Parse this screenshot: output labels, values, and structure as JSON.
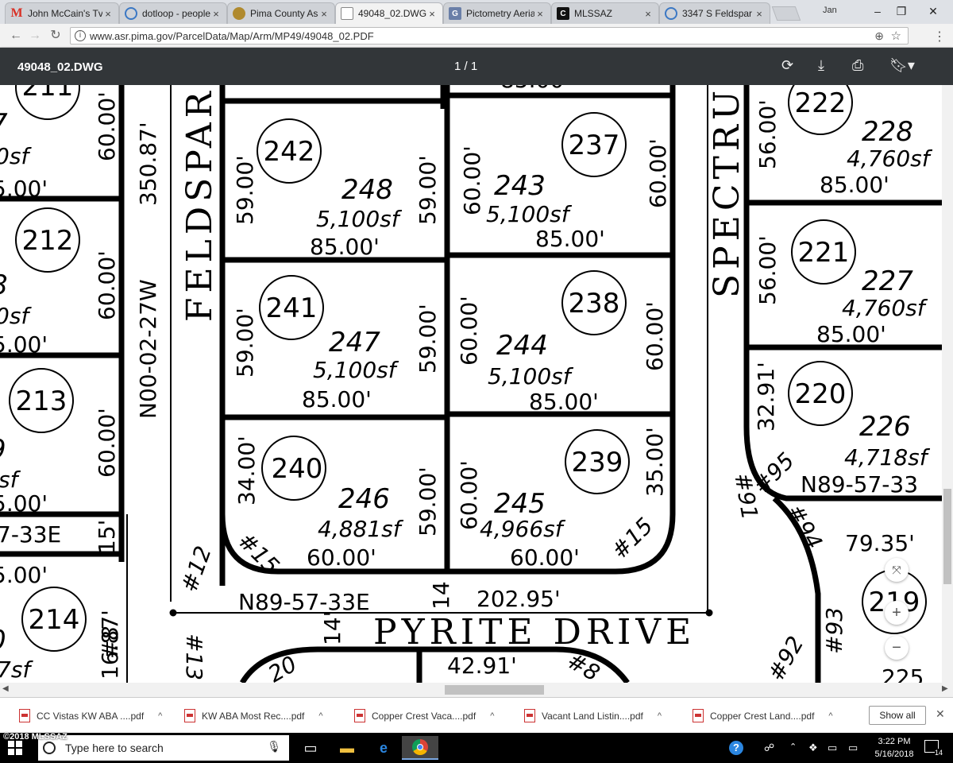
{
  "browser": {
    "tabs": [
      {
        "label": "John McCain's Tv",
        "icon": "gmail-icon",
        "active": false
      },
      {
        "label": "dotloop - people",
        "icon": "dotloop-icon",
        "active": false
      },
      {
        "label": "Pima County Ass",
        "icon": "pima-county-icon",
        "active": false
      },
      {
        "label": "49048_02.DWG",
        "icon": "document-icon",
        "active": true
      },
      {
        "label": "Pictometry Aeria",
        "icon": "pictometry-icon",
        "active": false
      },
      {
        "label": "MLSSAZ",
        "icon": "mlssaz-icon",
        "active": false
      },
      {
        "label": "3347 S Feldspar",
        "icon": "location-icon",
        "active": false
      }
    ],
    "user_label": "Jan",
    "url": "www.asr.pima.gov/ParcelData/Map/Arm/MP49/49048_02.PDF"
  },
  "pdf": {
    "filename": "49048_02.DWG",
    "page_indicator": "1  /  1"
  },
  "plat": {
    "street_labels": {
      "feldspar": "FELDSPAR",
      "spectrum": "SPECTRUM",
      "pyrite": "PYRITE  DRIVE"
    },
    "bearings": {
      "west_line": "N00-02-27W",
      "south_line": "N89-57-33E",
      "left_frag": "7-33E",
      "right_frag": "N89-57-33"
    },
    "distances": {
      "west_total": "350.87'",
      "south_total": "202.95'",
      "top_center": "85.00'",
      "lower_center": "42.91'",
      "right_79": "79.35'",
      "left_1687": "16.87'",
      "left_15": "15'",
      "row_14a": "14",
      "row_14b": "14'",
      "right_3291": "32.91'"
    },
    "lots": [
      {
        "map_no": "242",
        "lot": "248",
        "area": "5,100sf",
        "width": "85.00'",
        "depth_l": "59.00'",
        "depth_r": "59.00'"
      },
      {
        "map_no": "237",
        "lot": "243",
        "area": "5,100sf",
        "width": "85.00'",
        "depth_l": "60.00'",
        "depth_r": "60.00'"
      },
      {
        "map_no": "241",
        "lot": "247",
        "area": "5,100sf",
        "width": "85.00'",
        "depth_l": "59.00'",
        "depth_r": "59.00'"
      },
      {
        "map_no": "238",
        "lot": "244",
        "area": "5,100sf",
        "width": "85.00'",
        "depth_l": "60.00'",
        "depth_r": "60.00'"
      },
      {
        "map_no": "240",
        "lot": "246",
        "area": "4,881sf",
        "width": "60.00'",
        "depth_l": "34.00'",
        "depth_r": "59.00'"
      },
      {
        "map_no": "239",
        "lot": "245",
        "area": "4,966sf",
        "width": "60.00'",
        "depth_l": "60.00'",
        "depth_r": "35.00'"
      },
      {
        "map_no": "222",
        "lot": "228",
        "area": "4,760sf",
        "width": "85.00'",
        "depth_l": "56.00'"
      },
      {
        "map_no": "221",
        "lot": "227",
        "area": "4,760sf",
        "width": "85.00'",
        "depth_l": "56.00'"
      },
      {
        "map_no": "220",
        "lot": "226",
        "area": "4,718sf"
      },
      {
        "map_no": "219"
      },
      {
        "map_no": "211",
        "depth_r": "60.00'",
        "area_frag": "0sf",
        "width_frag": "5.00'",
        "lot_frag": "7"
      },
      {
        "map_no": "212",
        "depth_r": "60.00'",
        "area_frag": "0sf",
        "width_frag": "5.00'",
        "lot_frag": "8"
      },
      {
        "map_no": "213",
        "depth_r": "60.00'",
        "area_frag": "sf",
        "width_frag": "5.00'",
        "lot_frag": "9"
      },
      {
        "map_no": "214",
        "area_frag": "7sf",
        "width_frag": "5.00'",
        "lot_frag": "0"
      }
    ],
    "curve_labels": [
      "#12",
      "#13",
      "#15",
      "#15",
      "#91",
      "#95",
      "#94",
      "#93",
      "#92",
      "#8",
      "#8",
      "225",
      "20"
    ]
  },
  "downloads": [
    {
      "label": "CC Vistas KW ABA ....pdf"
    },
    {
      "label": "KW ABA Most Rec....pdf"
    },
    {
      "label": "Copper Crest Vaca....pdf"
    },
    {
      "label": "Vacant Land Listin....pdf"
    },
    {
      "label": "Copper Crest Land....pdf"
    }
  ],
  "show_all_label": "Show all",
  "taskbar": {
    "search_placeholder": "Type here to search",
    "time": "3:22 PM",
    "date": "5/16/2018",
    "notif_count": "14"
  },
  "watermark": "©2018 MLSSAZ"
}
